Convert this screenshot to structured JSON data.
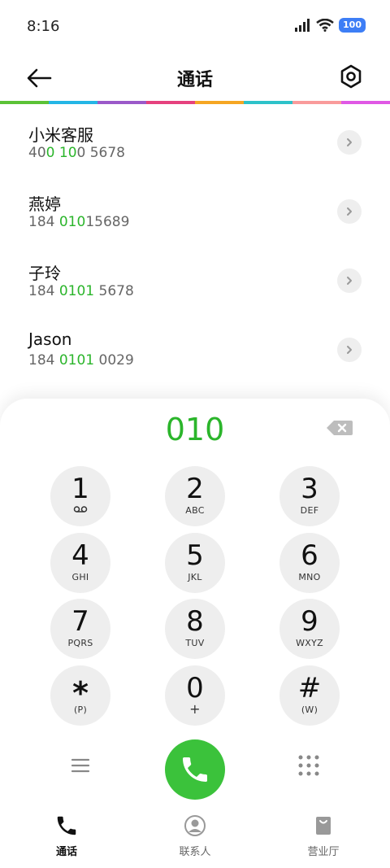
{
  "status_bar": {
    "time": "8:16",
    "battery": "100"
  },
  "header": {
    "title": "通话"
  },
  "rainbow_colors": [
    "#5bc236",
    "#24b6e6",
    "#9b59c9",
    "#e6417e",
    "#f5a623",
    "#2dc2c9",
    "#f99b9b",
    "#e058e5"
  ],
  "contacts": [
    {
      "name": "小米客服",
      "number_parts": [
        [
          "40",
          false
        ],
        [
          "0",
          true
        ],
        [
          " ",
          false
        ],
        [
          "10",
          true
        ],
        [
          "0 5678",
          false
        ]
      ]
    },
    {
      "name": "燕婷",
      "number_parts": [
        [
          "184 ",
          false
        ],
        [
          "010",
          true
        ],
        [
          "15689",
          false
        ]
      ]
    },
    {
      "name": "子玲",
      "number_parts": [
        [
          "184 ",
          false
        ],
        [
          "0101",
          true
        ],
        [
          " 5678",
          false
        ]
      ]
    },
    {
      "name": "Jason",
      "number_parts": [
        [
          "184 ",
          false
        ],
        [
          "0101",
          true
        ],
        [
          " 0029",
          false
        ]
      ]
    }
  ],
  "dial": {
    "number": "010",
    "keys": [
      {
        "digit": "1",
        "letters": "voicemail"
      },
      {
        "digit": "2",
        "letters": "ABC"
      },
      {
        "digit": "3",
        "letters": "DEF"
      },
      {
        "digit": "4",
        "letters": "GHI"
      },
      {
        "digit": "5",
        "letters": "JKL"
      },
      {
        "digit": "6",
        "letters": "MNO"
      },
      {
        "digit": "7",
        "letters": "PQRS"
      },
      {
        "digit": "8",
        "letters": "TUV"
      },
      {
        "digit": "9",
        "letters": "WXYZ"
      },
      {
        "digit": "*",
        "letters": "(P)"
      },
      {
        "digit": "0",
        "letters": "+"
      },
      {
        "digit": "#",
        "letters": "(W)"
      }
    ]
  },
  "bottom_nav": {
    "calls": "通话",
    "contacts": "联系人",
    "store": "营业厅"
  },
  "colors": {
    "accent_green": "#2bb52b",
    "call_button": "#3bc23b"
  }
}
